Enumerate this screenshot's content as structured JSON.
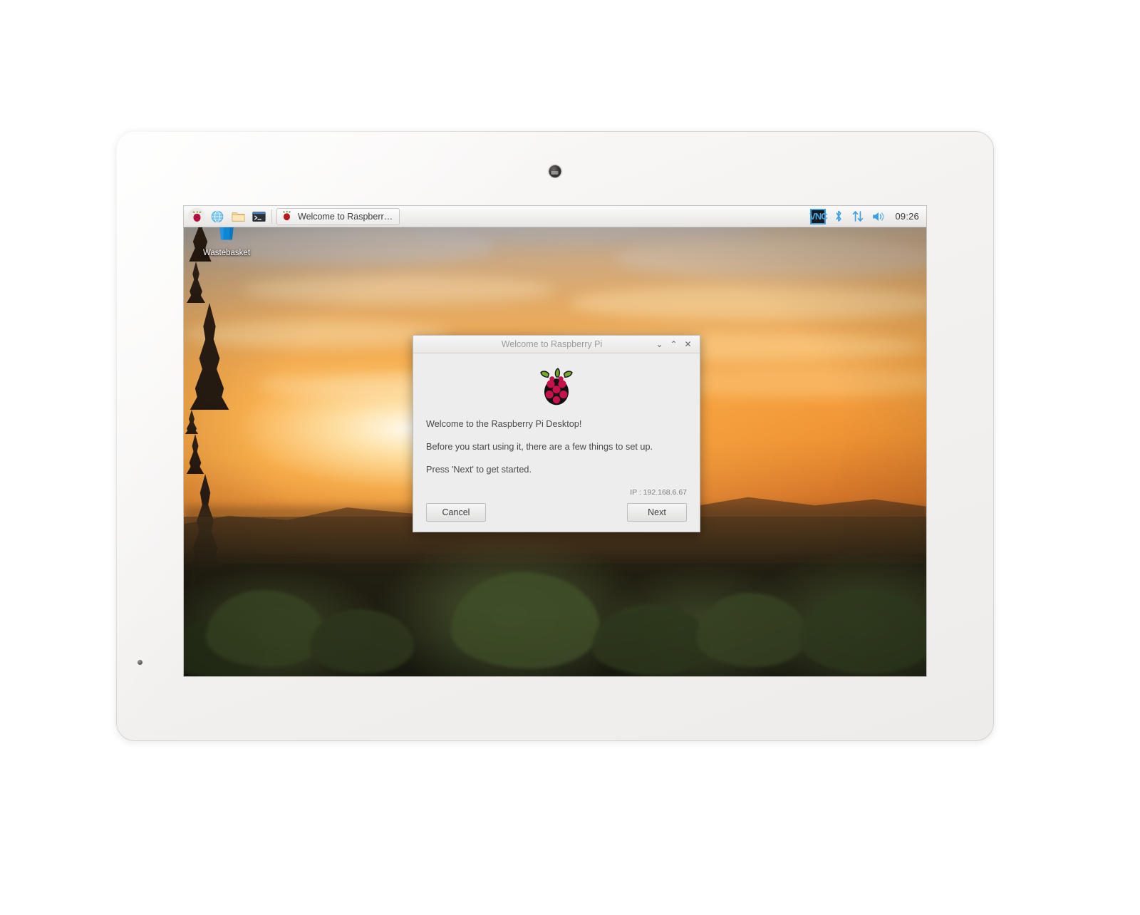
{
  "taskbar": {
    "launchers": [
      {
        "name": "menu-raspberry-icon",
        "label": "Menu"
      },
      {
        "name": "web-browser-icon",
        "label": "Web Browser"
      },
      {
        "name": "file-manager-icon",
        "label": "File Manager"
      },
      {
        "name": "terminal-icon",
        "label": "Terminal"
      }
    ],
    "task_button": {
      "label": "Welcome to Raspberr…",
      "icon": "raspberry-icon"
    },
    "tray": {
      "vnc_label": "VNC",
      "bluetooth_icon": "bluetooth-icon",
      "network_icon": "network-updown-icon",
      "volume_icon": "volume-icon",
      "clock": "09:26"
    }
  },
  "desktop": {
    "icons": [
      {
        "name": "wastebasket",
        "label": "Wastebasket"
      }
    ]
  },
  "dialog": {
    "title": "Welcome to Raspberry Pi",
    "controls": {
      "minimize": "⌄",
      "maximize": "⌃",
      "close": "✕"
    },
    "logo": "raspberry-pi-logo",
    "lines": [
      "Welcome to the Raspberry Pi Desktop!",
      "Before you start using it, there are a few things to set up.",
      "Press 'Next' to get started."
    ],
    "ip_text": "IP : 192.168.6.67",
    "cancel_label": "Cancel",
    "next_label": "Next"
  },
  "colors": {
    "accent_blue": "#3d9fe0",
    "raspberry": "#c5124a",
    "leaf_green": "#75a928",
    "wastebasket_blue": "#0d86d4"
  }
}
